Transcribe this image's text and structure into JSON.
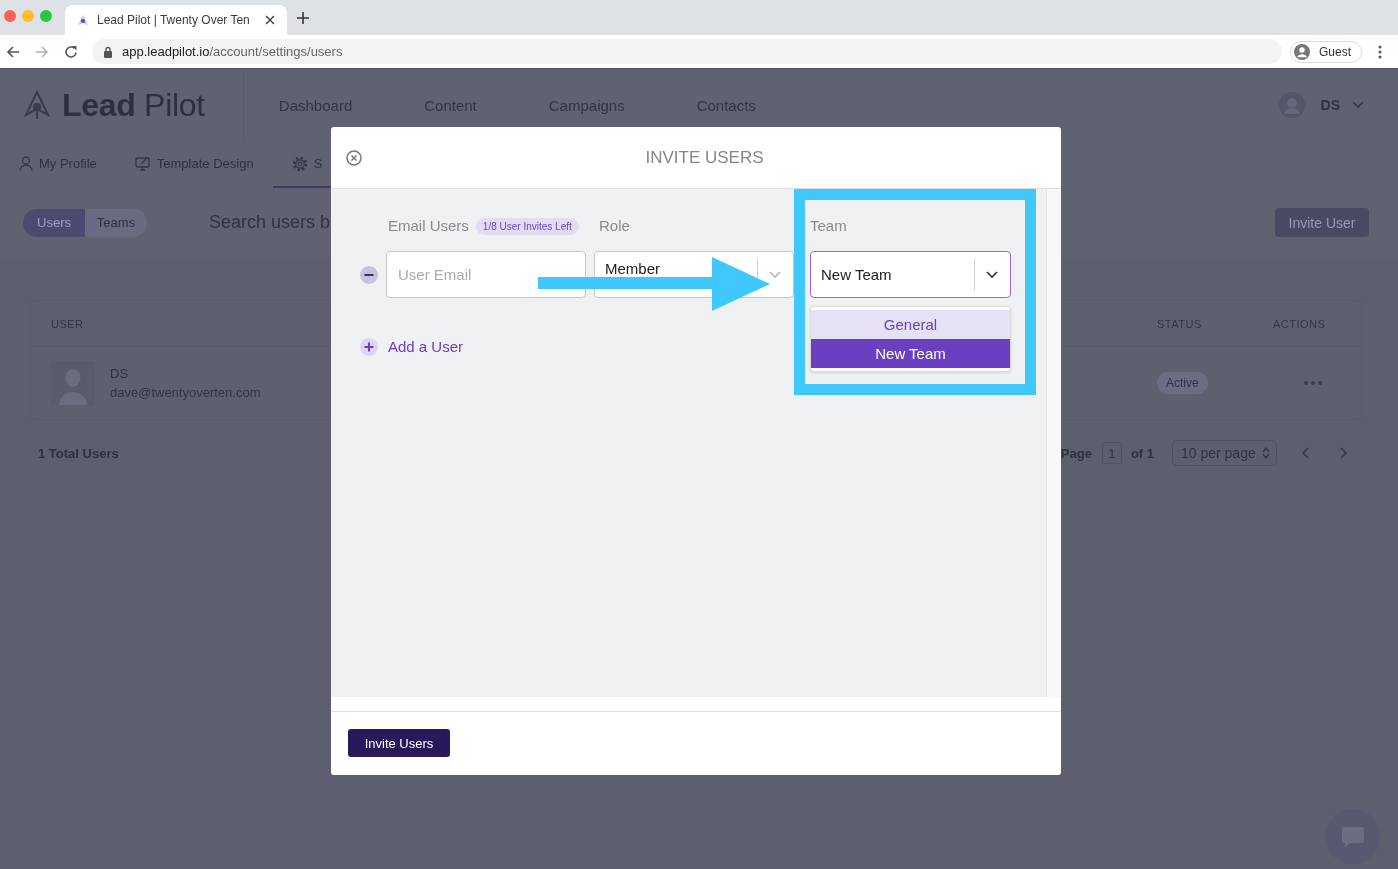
{
  "browser": {
    "tab_title": "Lead Pilot | Twenty Over Ten",
    "url_host": "app.leadpilot.io",
    "url_path": "/account/settings/users",
    "profile": "Guest"
  },
  "app_header": {
    "logo": "**Lead** Pilot",
    "nav": [
      {
        "label": "Dashboard"
      },
      {
        "label": "Content"
      },
      {
        "label": "Campaigns"
      },
      {
        "label": "Contacts"
      }
    ],
    "user_initials": "DS"
  },
  "settings_tabs": [
    {
      "label": "My Profile",
      "selected": false
    },
    {
      "label": "Template Design",
      "selected": false
    },
    {
      "label": "S",
      "selected": true
    }
  ],
  "toolbar": {
    "segments": [
      {
        "label": "Users",
        "selected": true
      },
      {
        "label": "Teams",
        "selected": false
      }
    ],
    "search": {
      "placeholder": "Search users b"
    },
    "invite_button": "Invite User"
  },
  "users_table": {
    "columns": [
      "USER",
      "STATUS",
      "ACTIONS"
    ],
    "rows": [
      {
        "name": "DS",
        "email": "dave@twentyoverten.com",
        "status": "Active"
      }
    ],
    "total": "1 Total Users"
  },
  "pagination": {
    "label": "Page",
    "page": "1",
    "of_pages": "of 1",
    "per_page": "10 per page"
  },
  "modal": {
    "title": "INVITE USERS",
    "labels": {
      "email": "Email Users",
      "role": "Role",
      "team": "Team"
    },
    "invites_badge": "1/8 User Invites Left",
    "invite_rows": [
      {
        "email": {
          "placeholder": "User Email"
        },
        "role": {
          "value": "Member",
          "expanded": false
        },
        "team": {
          "value": "New Team",
          "expanded": true,
          "options": [
            {
              "label": "General",
              "selected": false
            },
            {
              "label": "New Team",
              "selected": true
            }
          ]
        }
      }
    ],
    "add_user": "Add a User",
    "submit": "Invite Users"
  }
}
